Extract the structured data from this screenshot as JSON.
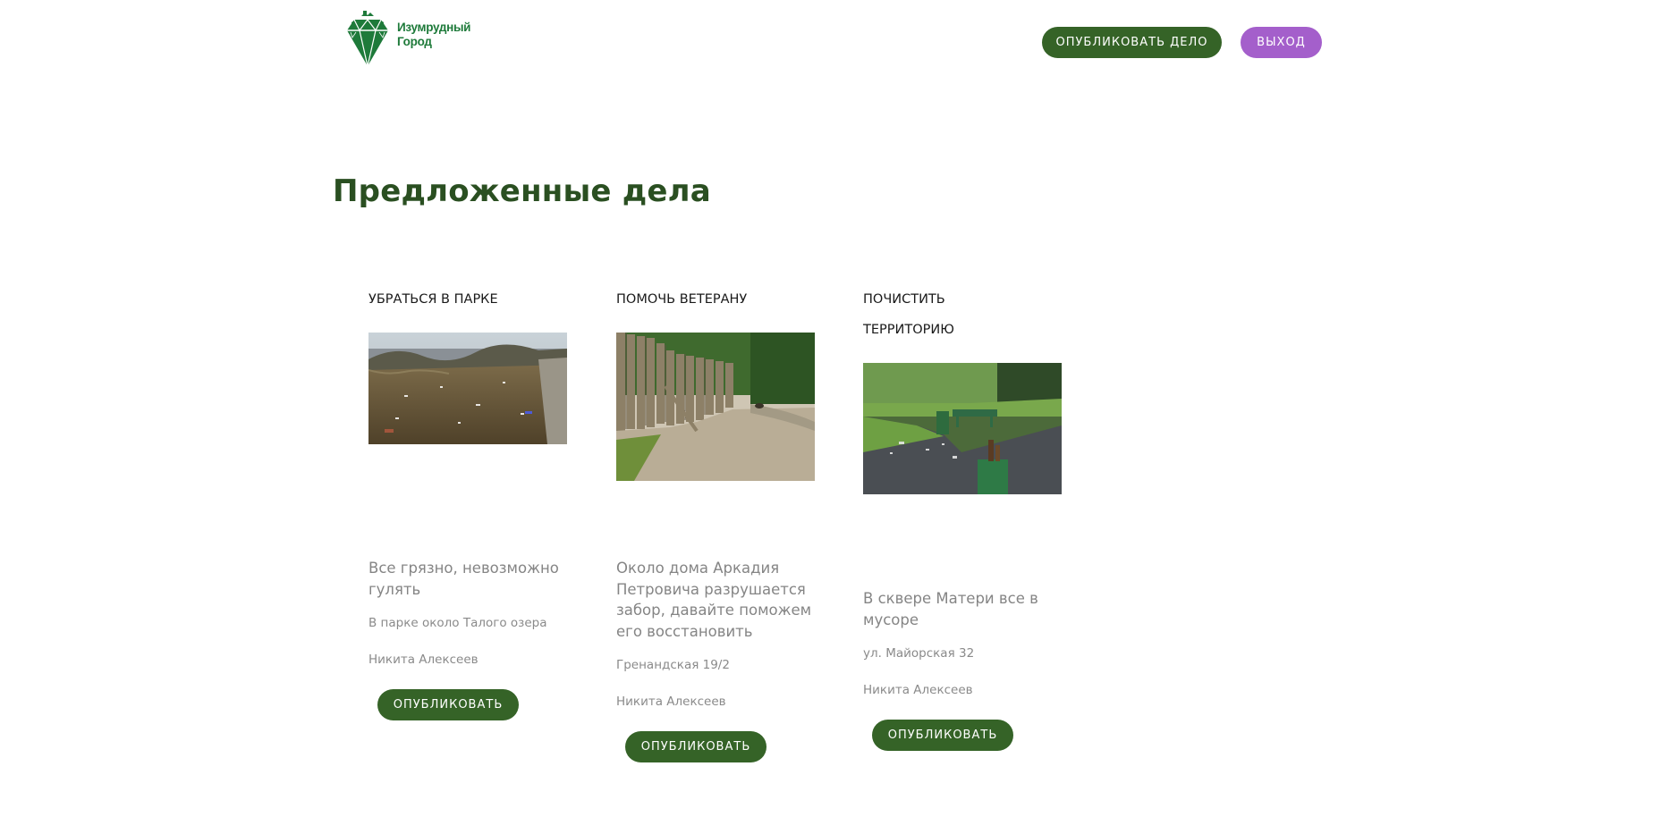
{
  "header": {
    "logo": {
      "line1": "Изумрудный",
      "line2": "Город",
      "icon": "emerald-gem-icon",
      "color": "#1e7a3a"
    },
    "publish_label": "Опубликовать дело",
    "exit_label": "Выход"
  },
  "main": {
    "title": "Предложенные дела",
    "cards": [
      {
        "title": "Убраться в парке",
        "image": "park-litter-photo",
        "description": "Все грязно, невозможно гулять",
        "address": "В парке около Талого озера",
        "author": "Никита Алексеев",
        "button_label": "Опубликовать"
      },
      {
        "title": "Помочь ветерану",
        "image": "broken-fence-photo",
        "description": "Около дома Аркадия Петровича разрушается забор, давайте поможем его восстановить",
        "address": "Гренандская 19/2",
        "author": "Никита Алексеев",
        "button_label": "Опубликовать"
      },
      {
        "title": "Почистить территорию",
        "image": "square-trash-bin-photo",
        "description": "В сквере Матери все в мусоре",
        "address": "ул. Майорская 32",
        "author": "Никита Алексеев",
        "button_label": "Опубликовать"
      }
    ]
  },
  "colors": {
    "primary_green": "#356327",
    "title_green": "#2a4f21",
    "accent_purple": "#a45fcb",
    "muted_text": "#858585"
  }
}
